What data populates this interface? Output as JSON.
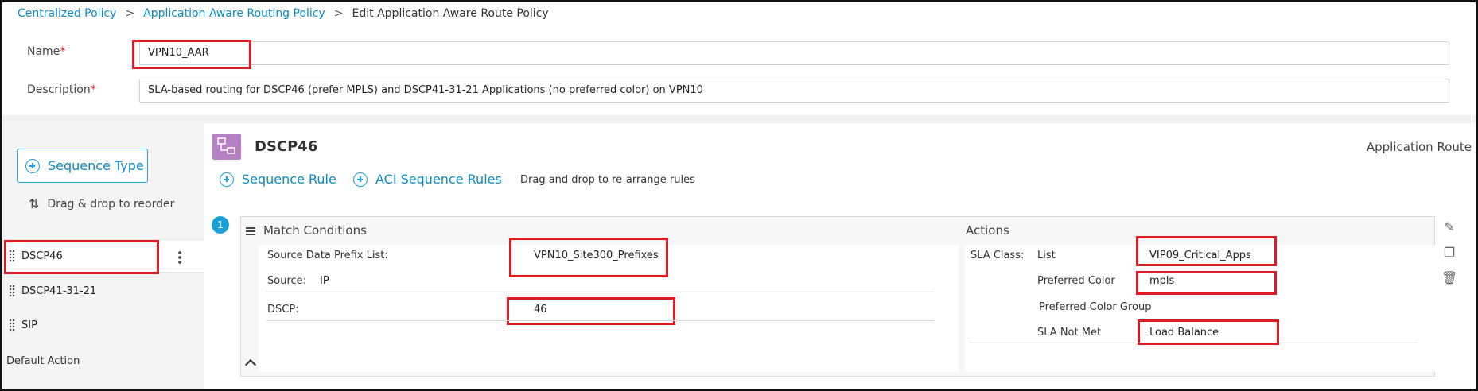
{
  "breadcrumb": {
    "items": [
      "Centralized Policy",
      "Application Aware Routing Policy"
    ],
    "current": "Edit Application Aware Route Policy",
    "separator": ">"
  },
  "form": {
    "name_label": "Name",
    "name_value": "VPN10_AAR",
    "description_label": "Description",
    "description_value": "SLA-based routing for DSCP46 (prefer MPLS) and DSCP41-31-21 Applications (no preferred color) on VPN10",
    "required_mark": "*"
  },
  "left_panel": {
    "sequence_type_label": "Sequence Type",
    "reorder_hint": "Drag & drop to reorder",
    "sequences": [
      "DSCP46",
      "DSCP41-31-21",
      "SIP"
    ],
    "default_action": "Default Action"
  },
  "sequence": {
    "title": "DSCP46",
    "type_label": "Application Route",
    "sequence_rule_label": "Sequence Rule",
    "aci_rules_label": "ACI Sequence Rules",
    "drag_hint": "Drag and drop to re-arrange rules"
  },
  "rule": {
    "number": "1",
    "match": {
      "title": "Match Conditions",
      "source_prefix_label": "Source Data Prefix List:",
      "source_prefix_value": "VPN10_Site300_Prefixes",
      "source_label": "Source:",
      "source_value": "IP",
      "dscp_label": "DSCP:",
      "dscp_value": "46"
    },
    "actions": {
      "title": "Actions",
      "sla_class_label": "SLA Class:",
      "list_label": "List",
      "list_value": "VIP09_Critical_Apps",
      "preferred_color_label": "Preferred Color",
      "preferred_color_value": "mpls",
      "preferred_color_group_label": "Preferred Color Group",
      "sla_not_met_label": "SLA Not Met",
      "sla_not_met_value": "Load Balance"
    }
  },
  "colors": {
    "link": "#0a8bc7",
    "accent": "#1aa0d6",
    "highlight": "#e01b24",
    "sequence_icon": "#b77fc4"
  },
  "icons": [
    "plus-circle-icon",
    "reorder-arrows-icon",
    "drag-grip-icon",
    "kebab-menu-icon",
    "sequence-icon",
    "hamburger-icon",
    "pencil-icon",
    "copy-icon",
    "trash-icon",
    "chevron-up-icon"
  ]
}
